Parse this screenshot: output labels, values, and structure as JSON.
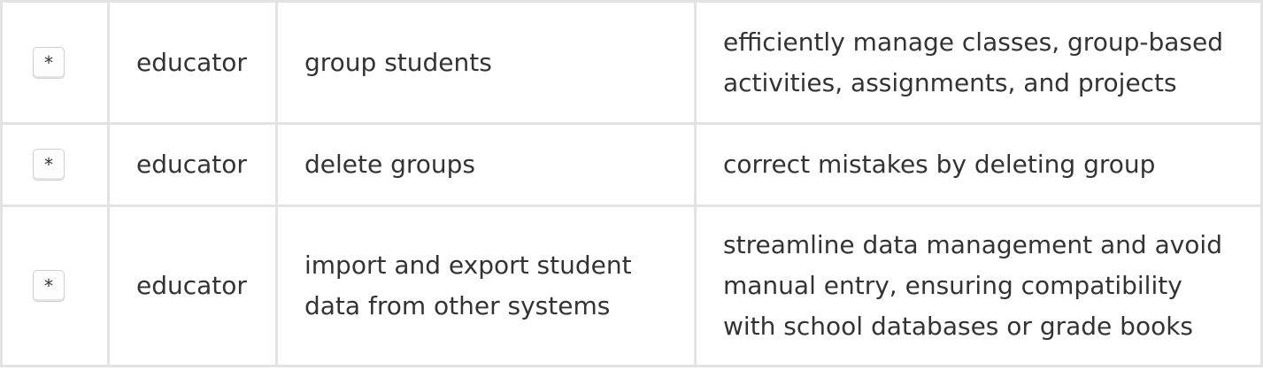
{
  "rows": [
    {
      "priority": "*",
      "role": "educator",
      "feature": "group students",
      "benefit": "efficiently manage classes, group-based activities, assignments, and projects"
    },
    {
      "priority": "*",
      "role": "educator",
      "feature": "delete groups",
      "benefit": "correct mistakes by deleting group"
    },
    {
      "priority": "*",
      "role": "educator",
      "feature": "import and export student data from other systems",
      "benefit": "streamline data management and avoid manual entry, ensuring compatibility with school databases or grade books"
    }
  ],
  "colors": {
    "border": "#e3e3e3",
    "text": "#333333"
  }
}
